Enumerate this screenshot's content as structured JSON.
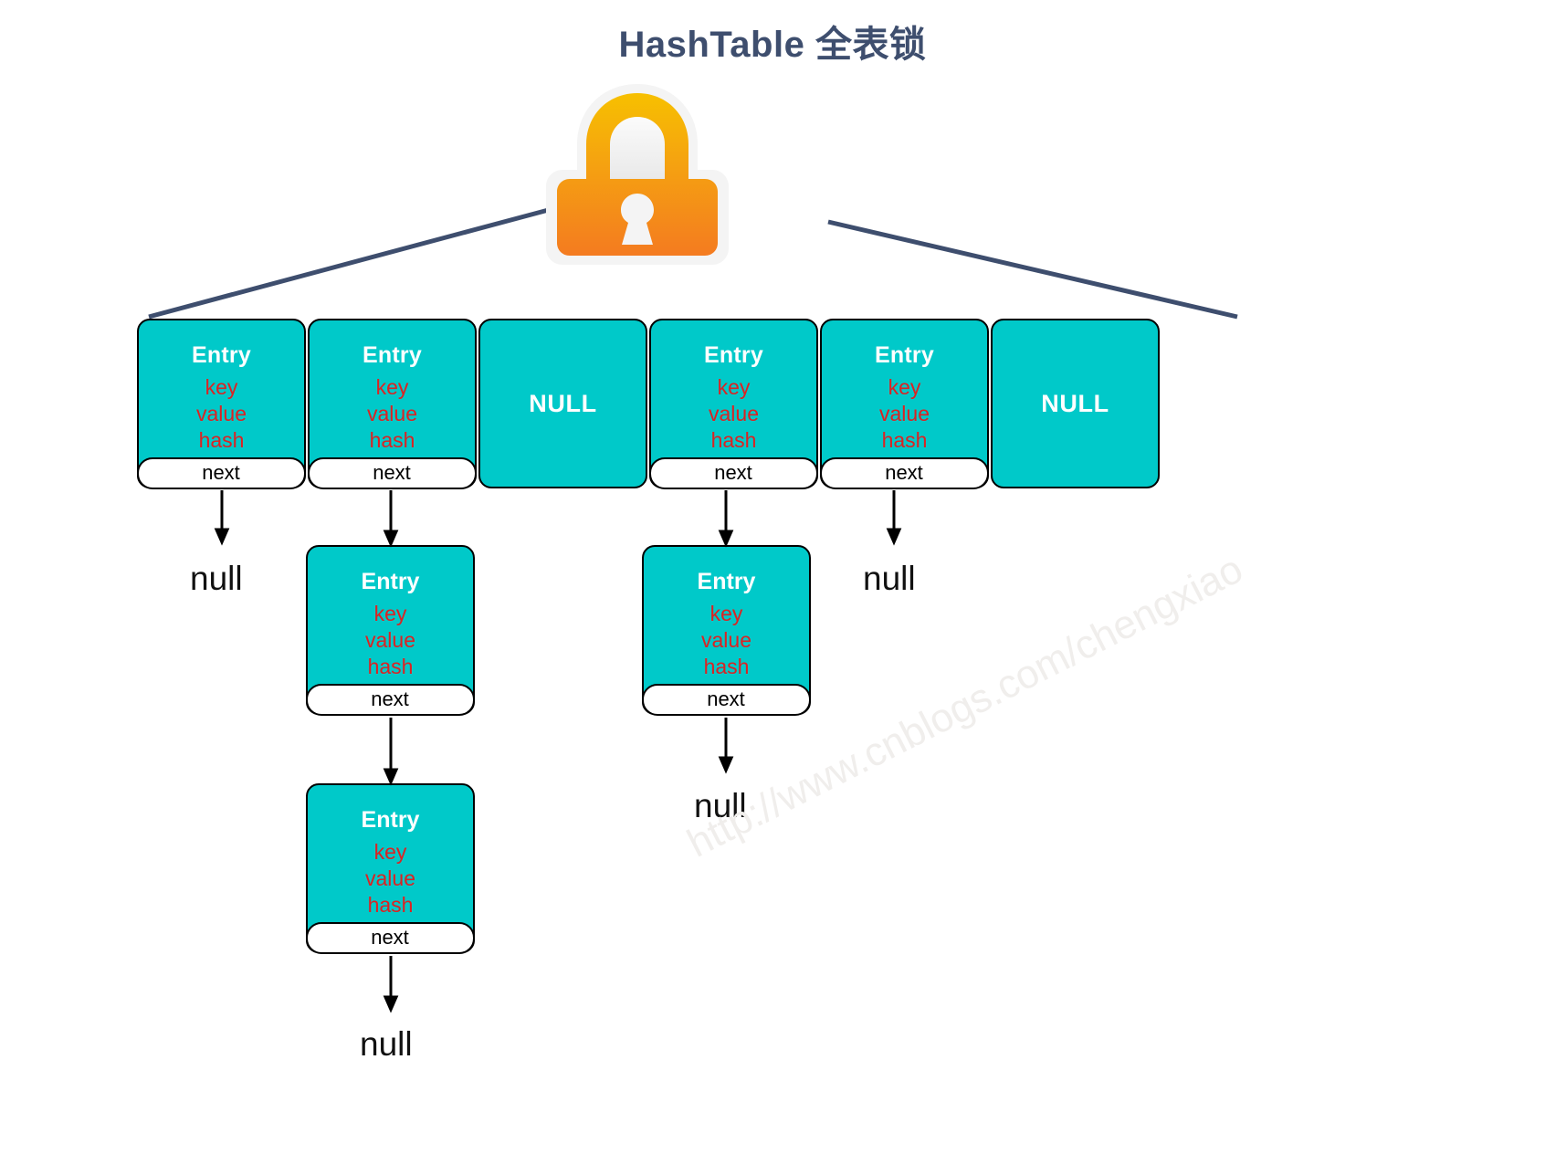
{
  "title": "HashTable 全表锁",
  "lock": {
    "icon": "padlock-icon",
    "gradient_top": "#f5b800",
    "gradient_bottom": "#f5822a",
    "outline": "#f2f2f2"
  },
  "colors": {
    "entry_fill": "#00c9c9",
    "entry_border": "#000000",
    "entry_title_text": "#ffffff",
    "field_text": "#dd2222",
    "next_fill": "#ffffff",
    "line": "#3e4e6e",
    "title": "#3e4e6e",
    "watermark": "#f0eeec"
  },
  "labels": {
    "entry": "Entry",
    "key": "key",
    "value": "value",
    "hash": "hash",
    "next": "next",
    "null_bucket": "NULL",
    "null_pointer": "null"
  },
  "buckets": [
    {
      "index": 0,
      "type": "entry",
      "title": "Entry",
      "fields": [
        "key",
        "value",
        "hash"
      ],
      "next_label": "next"
    },
    {
      "index": 1,
      "type": "entry",
      "title": "Entry",
      "fields": [
        "key",
        "value",
        "hash"
      ],
      "next_label": "next"
    },
    {
      "index": 2,
      "type": "null",
      "label": "NULL"
    },
    {
      "index": 3,
      "type": "entry",
      "title": "Entry",
      "fields": [
        "key",
        "value",
        "hash"
      ],
      "next_label": "next"
    },
    {
      "index": 4,
      "type": "entry",
      "title": "Entry",
      "fields": [
        "key",
        "value",
        "hash"
      ],
      "next_label": "next"
    },
    {
      "index": 5,
      "type": "null",
      "label": "NULL"
    }
  ],
  "chains": [
    {
      "bucket_index": 0,
      "nodes": [],
      "terminator": "null"
    },
    {
      "bucket_index": 1,
      "nodes": [
        {
          "title": "Entry",
          "fields": [
            "key",
            "value",
            "hash"
          ],
          "next_label": "next"
        },
        {
          "title": "Entry",
          "fields": [
            "key",
            "value",
            "hash"
          ],
          "next_label": "next"
        }
      ],
      "terminator": "null"
    },
    {
      "bucket_index": 3,
      "nodes": [
        {
          "title": "Entry",
          "fields": [
            "key",
            "value",
            "hash"
          ],
          "next_label": "next"
        }
      ],
      "terminator": "null"
    },
    {
      "bucket_index": 4,
      "nodes": [],
      "terminator": "null"
    }
  ],
  "nulls": {
    "bucket0_terminator": "null",
    "bucket4_terminator": "null",
    "bucket3_chain_terminator": "null",
    "bucket1_chain_terminator": "null"
  },
  "chain_nodes": {
    "b1_n1": {
      "title": "Entry",
      "key": "key",
      "value": "value",
      "hash": "hash",
      "next": "next"
    },
    "b1_n2": {
      "title": "Entry",
      "key": "key",
      "value": "value",
      "hash": "hash",
      "next": "next"
    },
    "b3_n1": {
      "title": "Entry",
      "key": "key",
      "value": "value",
      "hash": "hash",
      "next": "next"
    }
  },
  "watermark": "http://www.cnblogs.com/chengxiao"
}
